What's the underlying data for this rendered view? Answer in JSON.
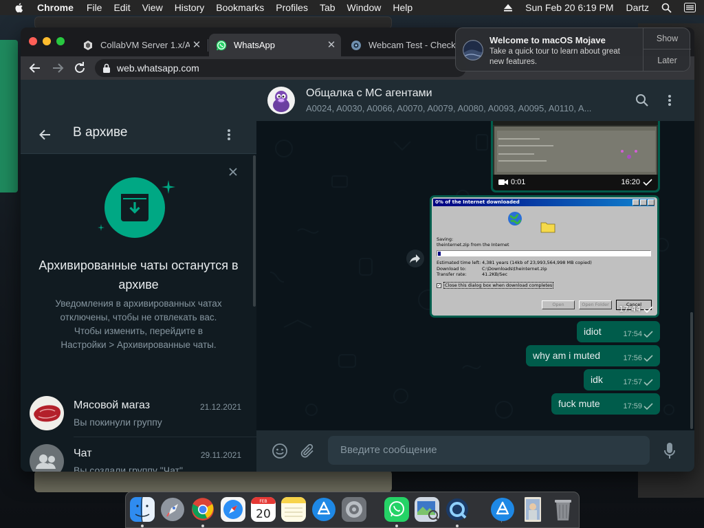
{
  "menubar": {
    "app": "Chrome",
    "items": [
      "File",
      "Edit",
      "View",
      "History",
      "Bookmarks",
      "Profiles",
      "Tab",
      "Window",
      "Help"
    ],
    "datetime": "Sun Feb 20  6:19 PM",
    "user": "Dartz"
  },
  "browser": {
    "tabs": [
      {
        "title": "CollabVM Server 1.x/Ac",
        "icon": "collabvm-icon"
      },
      {
        "title": "WhatsApp",
        "icon": "whatsapp-icon"
      },
      {
        "title": "Webcam Test - Check",
        "icon": "webcam-test-icon"
      }
    ],
    "url": "web.whatsapp.com"
  },
  "notification": {
    "title": "Welcome to macOS Mojave",
    "body": "Take a quick tour to learn about great new features.",
    "show": "Show",
    "later": "Later"
  },
  "sidebar": {
    "title": "В архиве",
    "info_heading": "Архивированные чаты останутся в архиве",
    "info_text": "Уведомления в архивированных чатах отключены, чтобы не отвлекать вас. Чтобы изменить, перейдите в Настройки > Архивированные чаты.",
    "chats": [
      {
        "name": "Мясовой магаз",
        "date": "21.12.2021",
        "last": "Вы покинули группу"
      },
      {
        "name": "Чат",
        "date": "29.11.2021",
        "last": "Вы создали группу \"Чат\""
      }
    ]
  },
  "conversation": {
    "name": "Общалка с МС агентами",
    "members": "A0024, A0030, A0066, A0070, A0079, A0080, A0093, A0095, A0110, A...",
    "video": {
      "duration": "0:01",
      "time": "16:20"
    },
    "image": {
      "time": "17:44",
      "dialog_title": "0% of the Internet downloaded",
      "saving": "Saving:",
      "file": "theinternet.zip from the Internet",
      "est_label": "Estimated time left:",
      "est_value": "4,381 years (14kb of 23,993,564,998 MB copied)",
      "dl_label": "Download to:",
      "dl_value": "C:\\Downloads\\theinternet.zip",
      "rate_label": "Transfer rate:",
      "rate_value": "41.2KB/Sec",
      "checkbox": "Close this dialog box when download completes",
      "btn_open": "Open",
      "btn_folder": "Open Folder",
      "btn_cancel": "Cancel"
    },
    "messages": [
      {
        "text": "idiot",
        "time": "17:54"
      },
      {
        "text": "why am i muted",
        "time": "17:56"
      },
      {
        "text": "idk",
        "time": "17:57"
      },
      {
        "text": "fuck mute",
        "time": "17:59"
      }
    ],
    "compose_placeholder": "Введите сообщение"
  },
  "dock": [
    "Finder",
    "Launchpad",
    "Google Chrome",
    "Safari",
    "Calendar",
    "Notes",
    "App Store",
    "System Preferences",
    "WhatsApp",
    "Preview",
    "QuickTime Player",
    "App Store",
    "Image",
    "Trash"
  ],
  "colors": {
    "accent": "#00a884",
    "outgoing_bubble": "#005c4b",
    "panel": "#202c33",
    "chat_bg": "#0b141a"
  }
}
